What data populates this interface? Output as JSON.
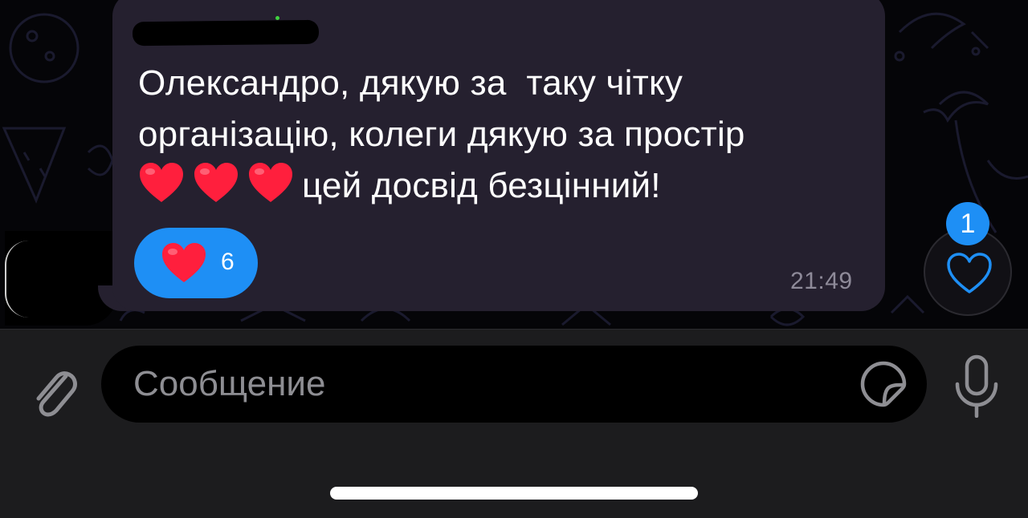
{
  "message": {
    "lines": [
      "Олександро, дякую за  таку чітку",
      "організацію, колеги дякую за простір"
    ],
    "line3_emojis": [
      "red-heart-emoji",
      "red-heart-emoji",
      "red-heart-emoji"
    ],
    "line3_text": "цей досвід безцінний!",
    "time": "21:49",
    "reaction": {
      "emoji": "red-heart-emoji",
      "count": "6"
    }
  },
  "reaction_button": {
    "icon": "heart-outline-icon",
    "badge": "1"
  },
  "composer": {
    "placeholder": "Сообщение",
    "attach_icon": "paperclip-icon",
    "sticker_icon": "sticker-icon",
    "mic_icon": "microphone-icon"
  },
  "colors": {
    "bubble": "#25202f",
    "accent": "#1e8ff5",
    "heart": "#ff1f3d",
    "timestamp": "#8e8a99"
  }
}
